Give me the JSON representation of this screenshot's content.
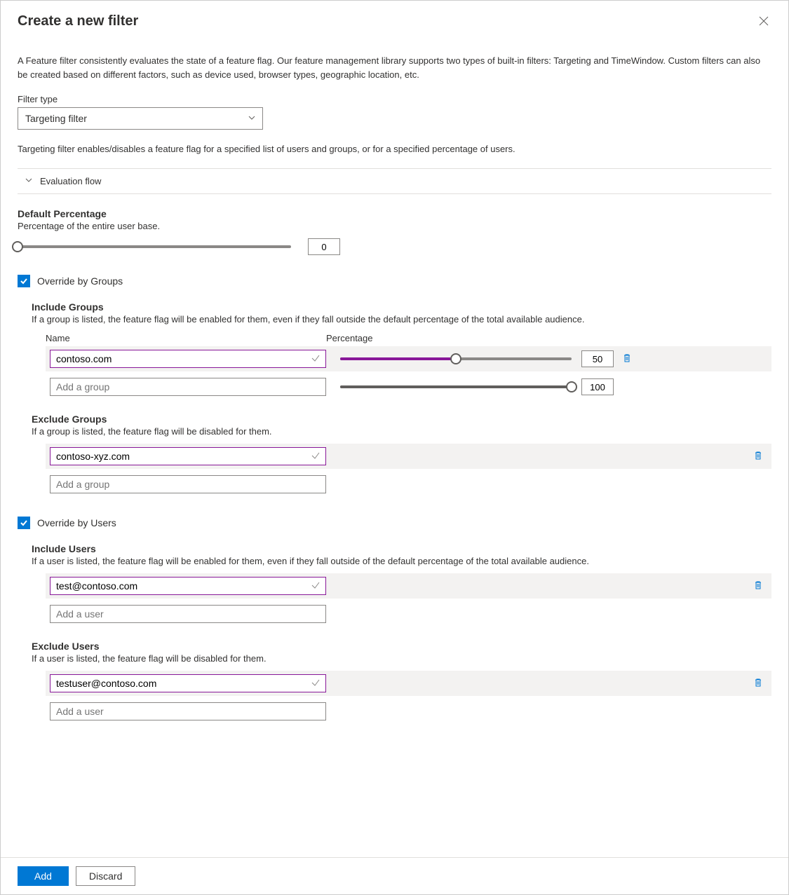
{
  "title": "Create a new filter",
  "description": "A Feature filter consistently evaluates the state of a feature flag. Our feature management library supports two types of built-in filters: Targeting and TimeWindow. Custom filters can also be created based on different factors, such as device used, browser types, geographic location, etc.",
  "filterType": {
    "label": "Filter type",
    "value": "Targeting filter"
  },
  "targetingInfo": "Targeting filter enables/disables a feature flag for a specified list of users and groups, or for a specified percentage of users.",
  "evaluationFlow": "Evaluation flow",
  "defaultPercentage": {
    "title": "Default Percentage",
    "subtext": "Percentage of the entire user base.",
    "value": "0"
  },
  "overrideGroups": {
    "label": "Override by Groups",
    "checked": true,
    "include": {
      "title": "Include Groups",
      "subtext": "If a group is listed, the feature flag will be enabled for them, even if they fall outside the default percentage of the total available audience.",
      "headers": {
        "name": "Name",
        "pct": "Percentage"
      },
      "rows": [
        {
          "name": "contoso.com",
          "pct": "50"
        }
      ],
      "addPlaceholder": "Add a group",
      "addPct": "100"
    },
    "exclude": {
      "title": "Exclude Groups",
      "subtext": "If a group is listed, the feature flag will be disabled for them.",
      "rows": [
        {
          "name": "contoso-xyz.com"
        }
      ],
      "addPlaceholder": "Add a group"
    }
  },
  "overrideUsers": {
    "label": "Override by Users",
    "checked": true,
    "include": {
      "title": "Include Users",
      "subtext": "If a user is listed, the feature flag will be enabled for them, even if they fall outside of the default percentage of the total available audience.",
      "rows": [
        {
          "name": "test@contoso.com"
        }
      ],
      "addPlaceholder": "Add a user"
    },
    "exclude": {
      "title": "Exclude Users",
      "subtext": "If a user is listed, the feature flag will be disabled for them.",
      "rows": [
        {
          "name": "testuser@contoso.com"
        }
      ],
      "addPlaceholder": "Add a user"
    }
  },
  "footer": {
    "add": "Add",
    "discard": "Discard"
  }
}
